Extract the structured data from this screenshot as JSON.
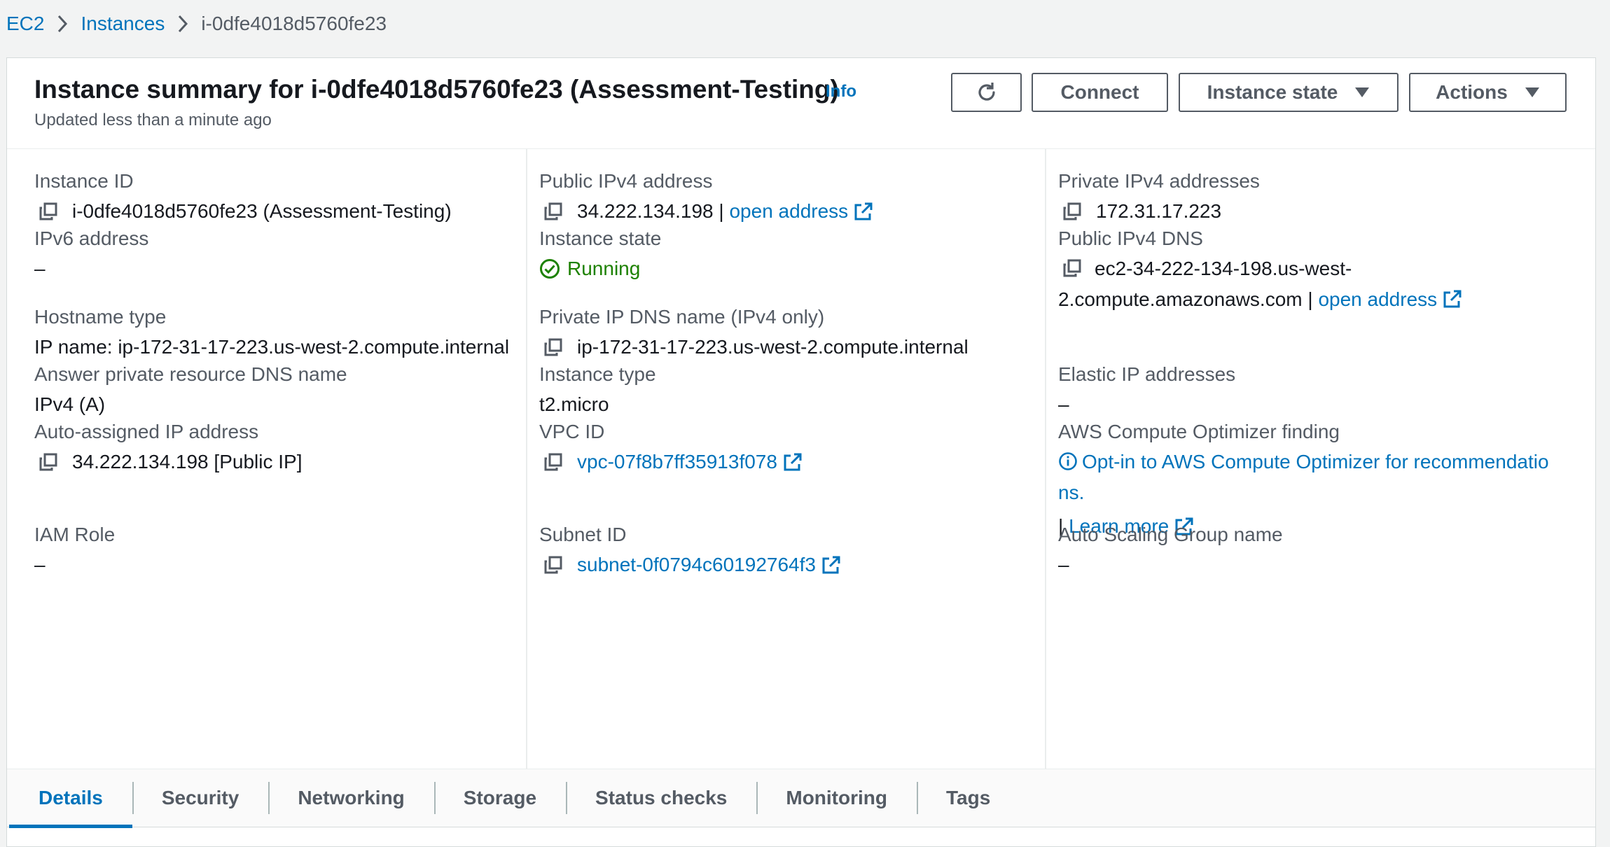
{
  "breadcrumb": {
    "items": [
      "EC2",
      "Instances",
      "i-0dfe4018d5760fe23"
    ]
  },
  "header": {
    "title": "Instance summary for i-0dfe4018d5760fe23 (Assessment-Testing)",
    "info": "Info",
    "updated": "Updated less than a minute ago",
    "buttons": {
      "connect": "Connect",
      "instance_state": "Instance state",
      "actions": "Actions"
    }
  },
  "details": {
    "instance_id": {
      "label": "Instance ID",
      "value": "i-0dfe4018d5760fe23 (Assessment-Testing)"
    },
    "public_ipv4": {
      "label": "Public IPv4 address",
      "value": "34.222.134.198",
      "sep": " | ",
      "link": "open address"
    },
    "private_ipv4": {
      "label": "Private IPv4 addresses",
      "value": "172.31.17.223"
    },
    "ipv6": {
      "label": "IPv6 address",
      "value": "–"
    },
    "instance_state": {
      "label": "Instance state",
      "value": "Running"
    },
    "public_dns": {
      "label": "Public IPv4 DNS",
      "value": "ec2-34-222-134-198.us-west-2.compute.amazonaws.com",
      "sep": " | ",
      "link": "open address"
    },
    "hostname_type": {
      "label": "Hostname type",
      "value": "IP name: ip-172-31-17-223.us-west-2.compute.internal"
    },
    "private_dns": {
      "label": "Private IP DNS name (IPv4 only)",
      "value": "ip-172-31-17-223.us-west-2.compute.internal"
    },
    "answer_dns": {
      "label": "Answer private resource DNS name",
      "value": "IPv4 (A)"
    },
    "instance_type": {
      "label": "Instance type",
      "value": "t2.micro"
    },
    "elastic_ip": {
      "label": "Elastic IP addresses",
      "value": "–"
    },
    "auto_ip": {
      "label": "Auto-assigned IP address",
      "value": "34.222.134.198 [Public IP]"
    },
    "vpc_id": {
      "label": "VPC ID",
      "value": "vpc-07f8b7ff35913f078"
    },
    "optimizer": {
      "label": "AWS Compute Optimizer finding",
      "link": "Opt-in to AWS Compute Optimizer for recommendations.",
      "sep": "| ",
      "learn_more": "Learn more"
    },
    "iam_role": {
      "label": "IAM Role",
      "value": "–"
    },
    "subnet_id": {
      "label": "Subnet ID",
      "value": "subnet-0f0794c60192764f3"
    },
    "asg_name": {
      "label": "Auto Scaling Group name",
      "value": "–"
    }
  },
  "tabs": [
    "Details",
    "Security",
    "Networking",
    "Storage",
    "Status checks",
    "Monitoring",
    "Tags"
  ],
  "active_tab": "Details",
  "colors": {
    "link": "#0073bb",
    "running": "#1d8102",
    "text": "#16191f",
    "muted": "#545b64"
  }
}
